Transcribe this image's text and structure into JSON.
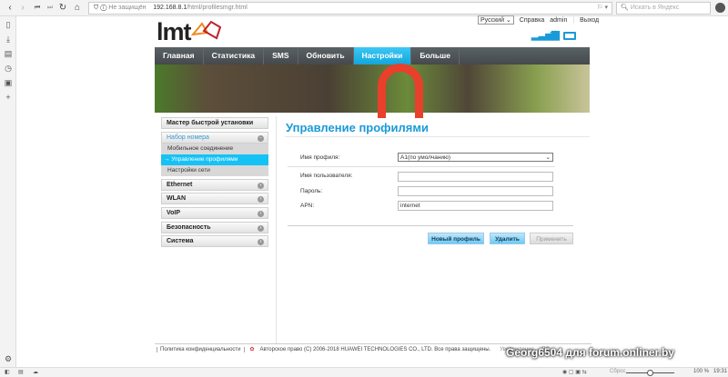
{
  "browser": {
    "security": "Не защищён",
    "url_host": "192.168.8.1",
    "url_path": "/html/profilesmgr.html",
    "search_placeholder": "Искать в Яндекс",
    "zoom": "100 %",
    "time": "19:31",
    "reset": "Сброс",
    "zoom_level": 0.5
  },
  "header": {
    "logo": "lmt",
    "language": "Русский",
    "help": "Справка",
    "user": "admin",
    "logout": "Выход"
  },
  "nav": [
    "Главная",
    "Статистика",
    "SMS",
    "Обновить",
    "Настройки",
    "Больше"
  ],
  "sidebar": {
    "wizard": "Мастер быстрой установки",
    "dial": "Набор номера",
    "sub": [
      "Мобильное соединение",
      "→ Управление профилями",
      "Настройки сети"
    ],
    "groups": [
      "Ethernet",
      "WLAN",
      "VoIP",
      "Безопасность",
      "Система"
    ]
  },
  "main": {
    "title": "Управление профилями",
    "profile_label": "Имя профиля:",
    "profile_value": "A1(по умолчанию)",
    "username_label": "Имя пользователя:",
    "username_value": "",
    "password_label": "Пароль:",
    "password_value": "",
    "apn_label": "APN:",
    "apn_value": "internet",
    "new_profile": "Новый профиль",
    "delete": "Удалить",
    "apply": "Применить"
  },
  "footer": {
    "privacy": "Политика конфиденциальности",
    "copyright": "Авторское право (C) 2006-2018 HUAWEI TECHNOLOGIES CO., LTD. Все права защищены.",
    "notice": "Уведомление ... ПО"
  },
  "watermark": "Georg6504 для forum.onliner.by",
  "colors": {
    "accent": "#15c2f5",
    "title": "#1a9ad8"
  }
}
